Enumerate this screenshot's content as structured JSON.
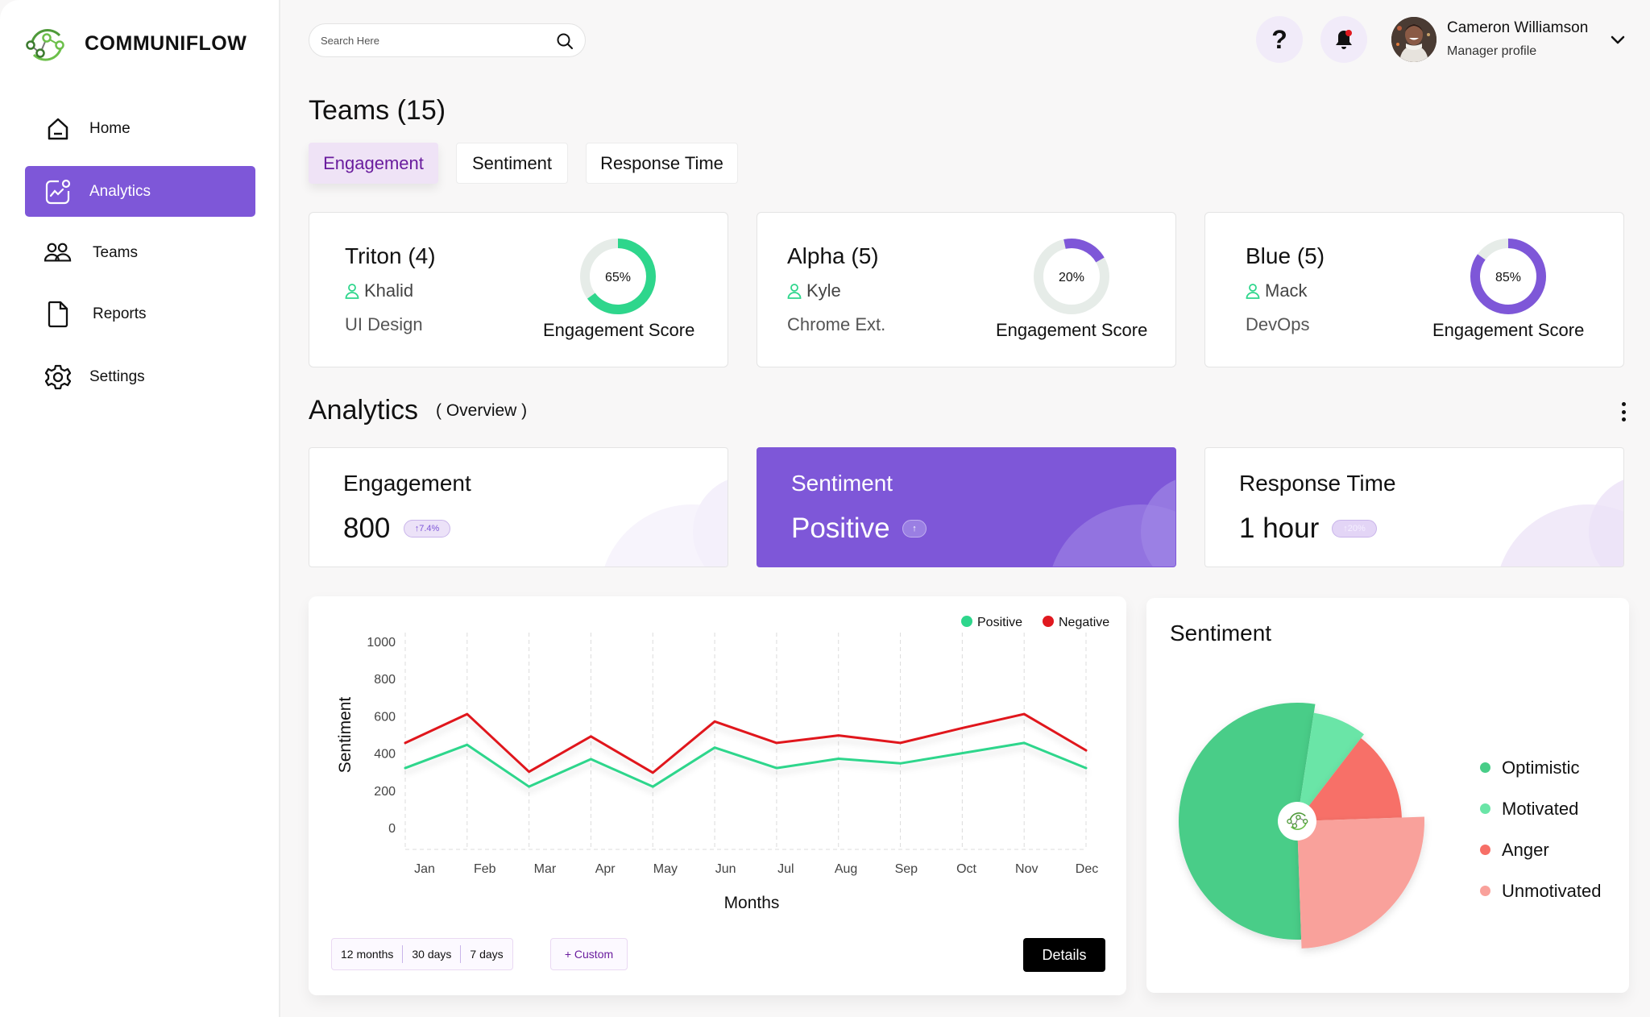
{
  "app": {
    "brand": "COMMUNIFLOW"
  },
  "sidebar": {
    "items": [
      {
        "label": "Home",
        "icon": "home-icon",
        "active": false
      },
      {
        "label": "Analytics",
        "icon": "analytics-icon",
        "active": true
      },
      {
        "label": "Teams",
        "icon": "teams-icon",
        "active": false
      },
      {
        "label": "Reports",
        "icon": "document-icon",
        "active": false
      },
      {
        "label": "Settings",
        "icon": "gear-icon",
        "active": false
      }
    ]
  },
  "topbar": {
    "search_placeholder": "Search Here",
    "help_label": "?",
    "user": {
      "name": "Cameron Williamson",
      "role": "Manager profile"
    }
  },
  "teams": {
    "title": "Teams (15)",
    "tabs": [
      {
        "label": "Engagement",
        "active": true
      },
      {
        "label": "Sentiment",
        "active": false
      },
      {
        "label": "Response Time",
        "active": false
      }
    ],
    "cards": [
      {
        "name": "Triton (4)",
        "lead": "Khalid",
        "department": "UI Design",
        "score": 65,
        "score_label": "65%",
        "metric_label": "Engagement Score",
        "color": "#2ed68c"
      },
      {
        "name": "Alpha (5)",
        "lead": "Kyle",
        "department": "Chrome Ext.",
        "score": 20,
        "score_label": "20%",
        "metric_label": "Engagement Score",
        "color": "#7e57d8"
      },
      {
        "name": "Blue (5)",
        "lead": "Mack",
        "department": "DevOps",
        "score": 85,
        "score_label": "85%",
        "metric_label": "Engagement Score",
        "color": "#7e57d8"
      }
    ]
  },
  "analytics": {
    "title": "Analytics",
    "subtitle": "( Overview )",
    "metrics": [
      {
        "title": "Engagement",
        "value": "800",
        "badge": "↑7.4%",
        "active": false
      },
      {
        "title": "Sentiment",
        "value": "Positive",
        "badge": "↑",
        "active": true
      },
      {
        "title": "Response Time",
        "value": "1 hour",
        "badge": "↑20%",
        "active": false
      }
    ],
    "range_buttons": [
      "12 months",
      "30 days",
      "7 days"
    ],
    "custom_label": "+ Custom",
    "details_label": "Details",
    "pie_title": "Sentiment"
  },
  "chart_data": [
    {
      "type": "line",
      "title": "",
      "xlabel": "Months",
      "ylabel": "Sentiment",
      "x": [
        "Jan",
        "Feb",
        "Mar",
        "Apr",
        "May",
        "Jun",
        "Jul",
        "Aug",
        "Sep",
        "Oct",
        "Nov",
        "Dec"
      ],
      "ylim": [
        0,
        1000
      ],
      "yticks": [
        0,
        200,
        400,
        600,
        800,
        1000
      ],
      "grid": "vertical-dashed",
      "legend": "top-right",
      "series": [
        {
          "name": "Positive",
          "color": "#2ed68c",
          "values": [
            320,
            445,
            220,
            368,
            220,
            430,
            320,
            370,
            345,
            400,
            455,
            320
          ]
        },
        {
          "name": "Negative",
          "color": "#e0191f",
          "values": [
            455,
            610,
            300,
            490,
            295,
            570,
            455,
            495,
            455,
            535,
            610,
            415
          ]
        }
      ]
    },
    {
      "type": "pie",
      "title": "Sentiment",
      "legend": "right",
      "slices": [
        {
          "label": "Optimistic",
          "value": 53,
          "color": "#48cd88"
        },
        {
          "label": "Motivated",
          "value": 8,
          "color": "#6ae5a7"
        },
        {
          "label": "Anger",
          "value": 14,
          "color": "#f76f67"
        },
        {
          "label": "Unmotivated",
          "value": 25,
          "color": "#f9a19b"
        }
      ]
    }
  ]
}
